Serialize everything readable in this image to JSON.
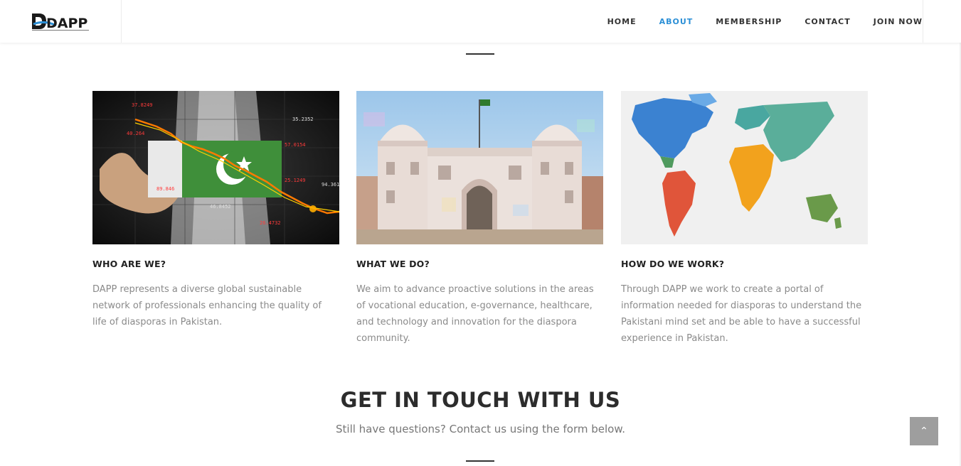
{
  "brand": {
    "logo_text": "DAPP"
  },
  "nav": {
    "items": [
      {
        "label": "HOME",
        "active": false
      },
      {
        "label": "ABOUT",
        "active": true
      },
      {
        "label": "MEMBERSHIP",
        "active": false
      },
      {
        "label": "CONTACT",
        "active": false
      },
      {
        "label": "JOIN NOW",
        "active": false
      }
    ],
    "active_color": "#2b8fd6"
  },
  "cards": [
    {
      "title": "WHO ARE WE?",
      "text": "DAPP represents a diverse global sustainable network of professionals enhancing the quality of life of diasporas in Pakistan.",
      "image": "pakistan-flag-market-chart",
      "image_numbers": [
        "37.8249",
        "40.264",
        "35.2352",
        "57.0154",
        "25.1249",
        "94.361",
        "89.846",
        "46.8452",
        "26.4732"
      ]
    },
    {
      "title": "WHAT WE DO?",
      "text": "We aim to advance proactive solutions in the areas of vocational education, e-governance, healthcare, and technology and innovation for the diaspora community.",
      "image": "lahore-fort-gate"
    },
    {
      "title": "HOW DO WE WORK?",
      "text": "Through DAPP we work to create a portal of information needed for diasporas to understand the Pakistani mind set and be able to have a successful experience in Pakistan.",
      "image": "world-map"
    }
  ],
  "contact": {
    "title": "GET IN TOUCH WITH US",
    "subtitle": "Still have questions? Contact us using the form below."
  },
  "back_to_top": {
    "icon": "chevron-up-icon"
  }
}
